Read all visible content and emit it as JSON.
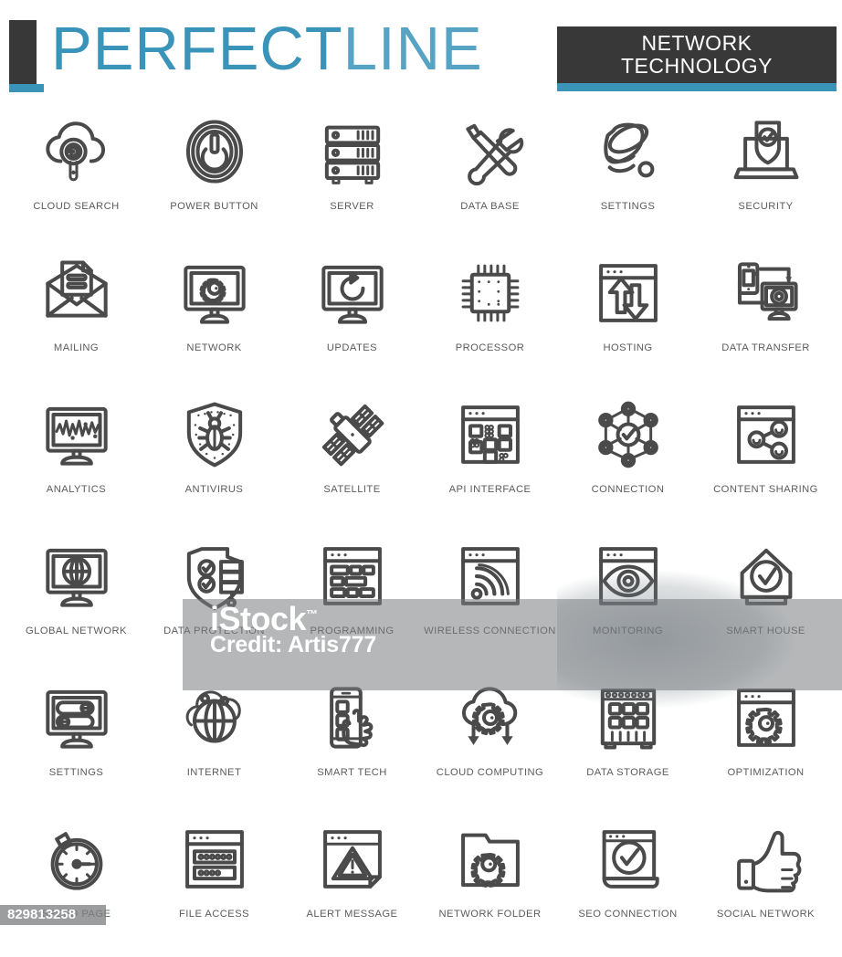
{
  "header": {
    "brand_primary": "PERFECT",
    "brand_secondary": "LINE",
    "badge_line1": "NETWORK",
    "badge_line2": "TECHNOLOGY",
    "accent_blue": "#3a93b8",
    "dark": "#383838"
  },
  "watermark": {
    "provider": "iStock",
    "tm": "™",
    "credit": "Credit: Artis777",
    "asset_id": "829813258"
  },
  "icons": [
    {
      "label": "CLOUD SEARCH",
      "icon": "cloud-search-icon"
    },
    {
      "label": "POWER BUTTON",
      "icon": "power-button-icon"
    },
    {
      "label": "SERVER",
      "icon": "server-icon"
    },
    {
      "label": "DATA BASE",
      "icon": "wrench-screwdriver-icon"
    },
    {
      "label": "SETTINGS",
      "icon": "database-cylinder-icon"
    },
    {
      "label": "SECURITY",
      "icon": "laptop-shield-icon"
    },
    {
      "label": "MAILING",
      "icon": "envelope-letter-icon"
    },
    {
      "label": "NETWORK",
      "icon": "monitor-gear-icon"
    },
    {
      "label": "UPDATES",
      "icon": "monitor-refresh-icon"
    },
    {
      "label": "PROCESSOR",
      "icon": "cpu-chip-icon"
    },
    {
      "label": "HOSTING",
      "icon": "browser-updown-arrows-icon"
    },
    {
      "label": "DATA TRANSFER",
      "icon": "phone-monitor-sync-icon"
    },
    {
      "label": "ANALYTICS",
      "icon": "monitor-graph-icon"
    },
    {
      "label": "ANTIVIRUS",
      "icon": "shield-bug-icon"
    },
    {
      "label": "SATELLITE",
      "icon": "satellite-icon"
    },
    {
      "label": "API INTERFACE",
      "icon": "browser-blocks-icon"
    },
    {
      "label": "CONNECTION",
      "icon": "network-nodes-check-icon"
    },
    {
      "label": "CONTENT SHARING",
      "icon": "browser-share-icon"
    },
    {
      "label": "GLOBAL NETWORK",
      "icon": "monitor-globe-icon"
    },
    {
      "label": "DATA PROTECTION",
      "icon": "shield-checks-server-icon"
    },
    {
      "label": "PROGRAMMING",
      "icon": "browser-code-blocks-icon"
    },
    {
      "label": "WIRELESS CONNECTION",
      "icon": "browser-wifi-icon"
    },
    {
      "label": "MONITORING",
      "icon": "browser-eye-icon"
    },
    {
      "label": "SMART HOUSE",
      "icon": "house-check-icon"
    },
    {
      "label": "SETTINGS",
      "icon": "monitor-toggles-icon"
    },
    {
      "label": "INTERNET",
      "icon": "globe-cloud-icon"
    },
    {
      "label": "SMART TECH",
      "icon": "phone-hand-touch-icon"
    },
    {
      "label": "CLOUD COMPUTING",
      "icon": "cloud-gear-arrows-icon"
    },
    {
      "label": "DATA STORAGE",
      "icon": "storage-rack-icon"
    },
    {
      "label": "OPTIMIZATION",
      "icon": "browser-gear-icon"
    },
    {
      "label": "SPEED PAGE",
      "icon": "stopwatch-icon"
    },
    {
      "label": "FILE ACCESS",
      "icon": "browser-password-fields-icon"
    },
    {
      "label": "ALERT MESSAGE",
      "icon": "document-warning-icon"
    },
    {
      "label": "NETWORK FOLDER",
      "icon": "folder-gear-icon"
    },
    {
      "label": "SEO CONNECTION",
      "icon": "browser-check-icon"
    },
    {
      "label": "SOCIAL NETWORK",
      "icon": "thumbs-up-icon"
    }
  ]
}
